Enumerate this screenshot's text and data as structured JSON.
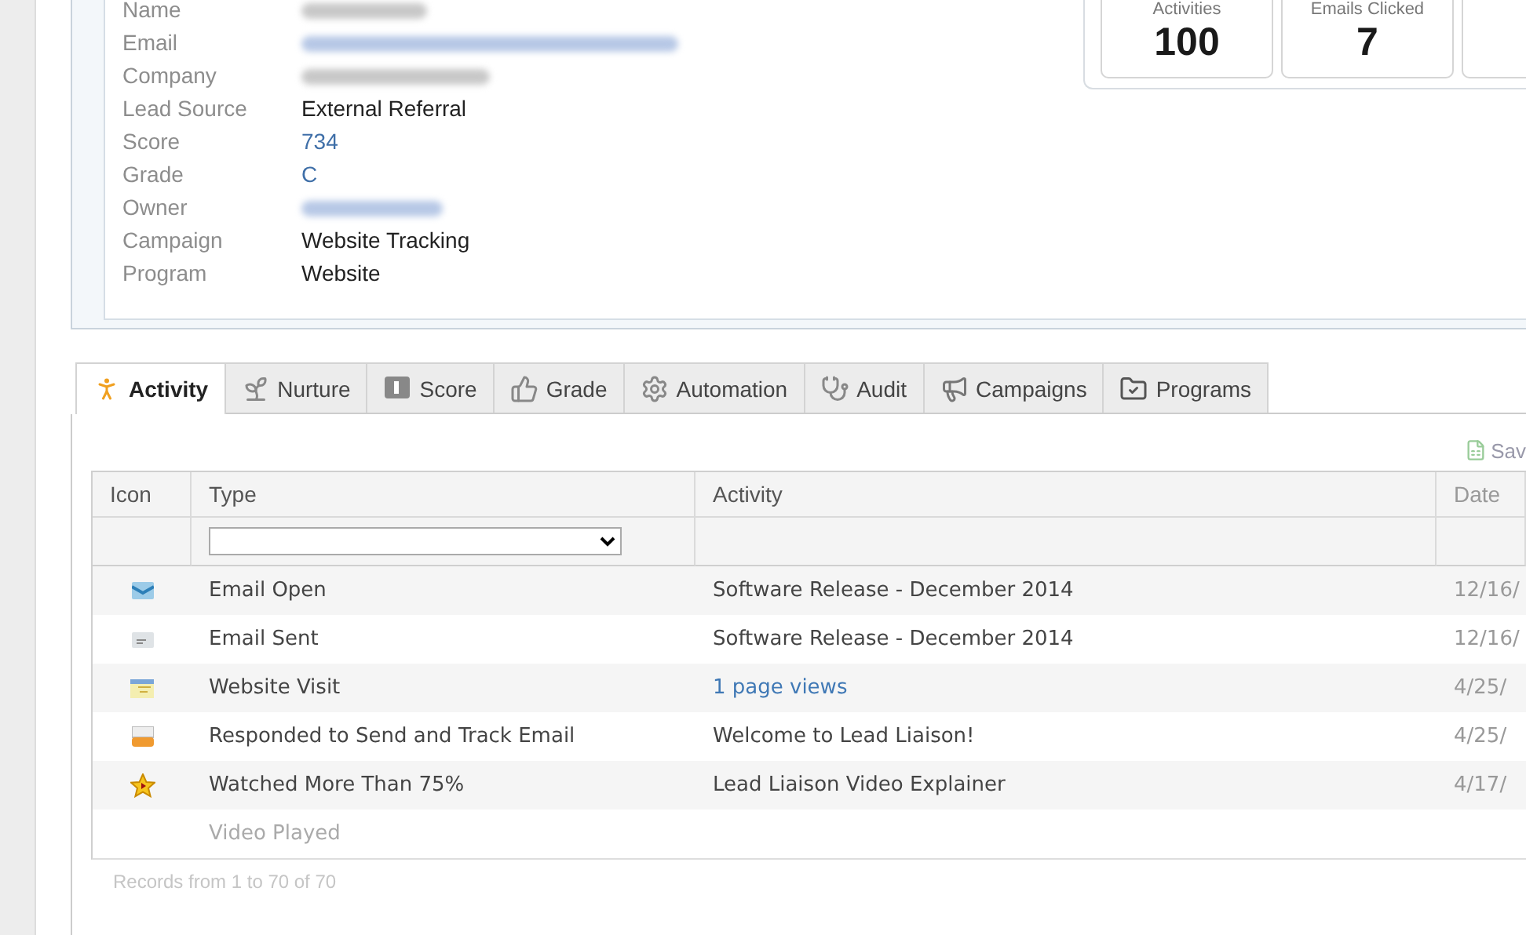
{
  "lead_fields": [
    {
      "label": "Name",
      "kind": "blurred",
      "link": false
    },
    {
      "label": "Email",
      "kind": "blurred",
      "link": true
    },
    {
      "label": "Company",
      "kind": "blurred",
      "link": false
    },
    {
      "label": "Lead Source",
      "kind": "text",
      "value": "External Referral",
      "link": false
    },
    {
      "label": "Score",
      "kind": "text",
      "value": "734",
      "link": true
    },
    {
      "label": "Grade",
      "kind": "text",
      "value": "C",
      "link": true
    },
    {
      "label": "Owner",
      "kind": "blurred",
      "link": true
    },
    {
      "label": "Campaign",
      "kind": "text",
      "value": "Website Tracking",
      "link": false
    },
    {
      "label": "Program",
      "kind": "text",
      "value": "Website",
      "link": false
    }
  ],
  "stats": [
    {
      "label": "Activities",
      "value": "100"
    },
    {
      "label": "Emails Clicked",
      "value": "7"
    }
  ],
  "tabs": [
    {
      "label": "Activity",
      "selected": true
    },
    {
      "label": "Nurture",
      "selected": false
    },
    {
      "label": "Score",
      "selected": false
    },
    {
      "label": "Grade",
      "selected": false
    },
    {
      "label": "Automation",
      "selected": false
    },
    {
      "label": "Audit",
      "selected": false
    },
    {
      "label": "Campaigns",
      "selected": false
    },
    {
      "label": "Programs",
      "selected": false
    }
  ],
  "save_button": "Sav",
  "table": {
    "columns": [
      "Icon",
      "Type",
      "Activity",
      "Date"
    ],
    "rows": [
      {
        "kind": "email-open",
        "type": "Email Open",
        "activity": "Software Release - December 2014",
        "activity_link": false,
        "date": "12/16/"
      },
      {
        "kind": "email-sent",
        "type": "Email Sent",
        "activity": "Software Release - December 2014",
        "activity_link": false,
        "date": "12/16/"
      },
      {
        "kind": "web",
        "type": "Website Visit",
        "activity": "1 page views",
        "activity_link": true,
        "date": "4/25/"
      },
      {
        "kind": "responded",
        "type": "Responded to Send and Track Email",
        "activity": "Welcome to Lead Liaison!",
        "activity_link": false,
        "date": "4/25/"
      },
      {
        "kind": "star",
        "type": "Watched More Than 75%",
        "activity": "Lead Liaison Video Explainer",
        "activity_link": false,
        "date": "4/17/"
      },
      {
        "kind": "faded",
        "type": "Video Played"
      }
    ]
  },
  "footer": "Records from 1 to 70 of 70"
}
